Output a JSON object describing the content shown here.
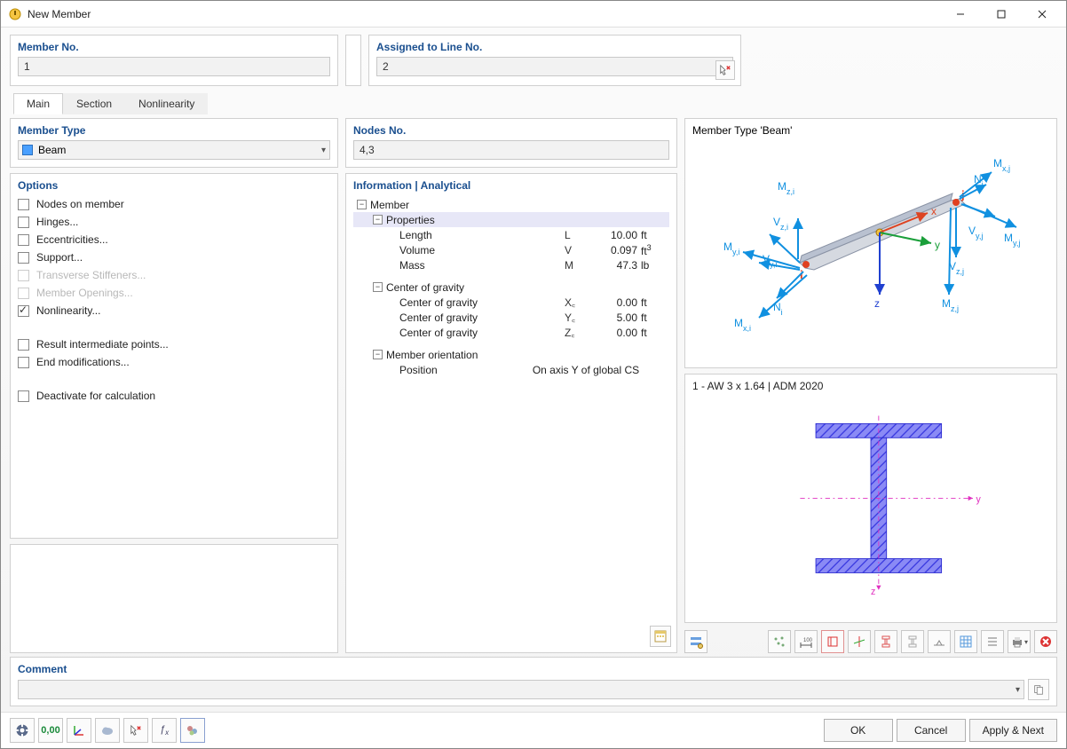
{
  "window": {
    "title": "New Member"
  },
  "header": {
    "member_no_label": "Member No.",
    "member_no_value": "1",
    "assigned_label": "Assigned to Line No.",
    "assigned_value": "2"
  },
  "tabs": {
    "main": "Main",
    "section": "Section",
    "nonlinearity": "Nonlinearity"
  },
  "member_type": {
    "label": "Member Type",
    "value": "Beam"
  },
  "options": {
    "label": "Options",
    "items": [
      {
        "label": "Nodes on member",
        "checked": false,
        "disabled": false
      },
      {
        "label": "Hinges...",
        "checked": false,
        "disabled": false
      },
      {
        "label": "Eccentricities...",
        "checked": false,
        "disabled": false
      },
      {
        "label": "Support...",
        "checked": false,
        "disabled": false
      },
      {
        "label": "Transverse Stiffeners...",
        "checked": false,
        "disabled": true
      },
      {
        "label": "Member Openings...",
        "checked": false,
        "disabled": true
      },
      {
        "label": "Nonlinearity...",
        "checked": true,
        "disabled": false
      },
      {
        "label": "Result intermediate points...",
        "checked": false,
        "disabled": false
      },
      {
        "label": "End modifications...",
        "checked": false,
        "disabled": false
      },
      {
        "label": "Deactivate for calculation",
        "checked": false,
        "disabled": false
      }
    ]
  },
  "mid": {
    "nodes_label": "Nodes No.",
    "nodes_value": "4,3",
    "info_label": "Information | Analytical",
    "member": "Member",
    "properties": "Properties",
    "length": "Length",
    "length_sym": "L",
    "length_val": "10.00",
    "length_unit": "ft",
    "volume": "Volume",
    "volume_sym": "V",
    "volume_val": "0.097",
    "volume_unit": "ft",
    "mass": "Mass",
    "mass_sym": "M",
    "mass_val": "47.3",
    "mass_unit": "lb",
    "cog_head": "Center of gravity",
    "cog_x": "Center of gravity",
    "cog_x_sym": "X꜀",
    "cog_x_val": "0.00",
    "cog_x_unit": "ft",
    "cog_y": "Center of gravity",
    "cog_y_sym": "Y꜀",
    "cog_y_val": "5.00",
    "cog_y_unit": "ft",
    "cog_z": "Center of gravity",
    "cog_z_sym": "Z꜀",
    "cog_z_val": "0.00",
    "cog_z_unit": "ft",
    "orient_head": "Member orientation",
    "position_lbl": "Position",
    "position_val": "On axis Y of global CS"
  },
  "right": {
    "preview_title": "Member Type 'Beam'",
    "cs_title": "1 - AW 3 x 1.64 | ADM 2020",
    "diagram": {
      "nj": "Nⱼ",
      "ni": "Nᵢ",
      "mxj": "Mₓ,ⱼ",
      "mxi": "Mₓ,ᵢ",
      "myj": "Mᵧ,ⱼ",
      "myi": "Mᵧ,ᵢ",
      "mzj": "M_z,ⱼ",
      "mzi": "M_z,ᵢ",
      "vyj": "Vᵧ,ⱼ",
      "vyi": "Vᵧ,ᵢ",
      "vzj": "V_z,ⱼ",
      "vzi": "V_z,ᵢ",
      "x": "x",
      "y": "y",
      "z": "z",
      "i": "i",
      "j": "j"
    },
    "cs_axes": {
      "y": "y",
      "z": "z"
    }
  },
  "comment": {
    "label": "Comment",
    "value": ""
  },
  "footer": {
    "ok": "OK",
    "cancel": "Cancel",
    "apply_next": "Apply & Next"
  }
}
